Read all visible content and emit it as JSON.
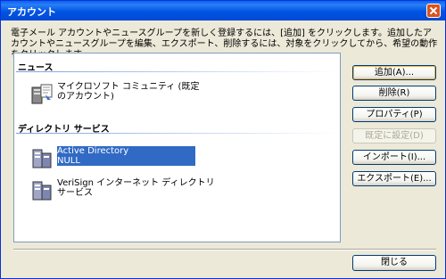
{
  "window": {
    "title": "アカウント",
    "description": "電子メール アカウントやニュースグループを新しく登録するには、[追加] をクリックします。追加したアカウントやニュースグループを編集、エクスポート、削除するには、対象をクリックしてから、希望の動作をクリックします。"
  },
  "accounts": {
    "groups": [
      {
        "name": "ニュース",
        "items": [
          {
            "label": "マイクロソフト コミュニティ (既定のアカウント)",
            "icon": "news-server-icon",
            "selected": false
          }
        ]
      },
      {
        "name": "ディレクトリ サービス",
        "items": [
          {
            "label": "Active Directory\nNULL",
            "icon": "directory-server-icon",
            "selected": true
          },
          {
            "label": "VeriSign インターネット ディレクトリ サービス",
            "icon": "directory-server-icon",
            "selected": false
          }
        ]
      }
    ]
  },
  "buttons": {
    "add": "追加(A)...",
    "remove": "削除(R)",
    "properties": "プロパティ(P)",
    "set_default": "既定に設定(D)",
    "import": "インポート(I)...",
    "export": "エクスポート(E)...",
    "close": "閉じる"
  },
  "colors": {
    "titlebar": "#0054E3",
    "selection": "#316AC5",
    "close_button": "#D9531E",
    "dialog_bg": "#ECE9D8"
  }
}
